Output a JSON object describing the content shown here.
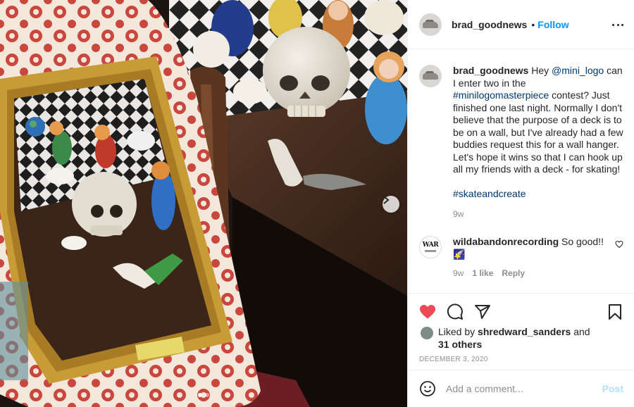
{
  "header": {
    "username": "brad_goodnews",
    "separator": "•",
    "follow_label": "Follow"
  },
  "caption": {
    "username": "brad_goodnews",
    "text_1": "Hey",
    "mention": "@mini_logo",
    "text_2": "can I enter two in the",
    "hashtag_1": "#minilogomasterpiece",
    "text_3": "contest? Just finished one last night. Normally I don't believe that the purpose of a deck is to be on a wall, but I've already had a few buddies request this for a wall hanger. Let's hope it wins so that I can hook up all my friends with a deck - for skating!",
    "hashtag_2": "#skateandcreate",
    "time": "9w"
  },
  "reply": {
    "avatar_text": "WAR",
    "username": "wildabandonrecording",
    "text": "So good!!",
    "emoji": "🌠",
    "time": "9w",
    "likes": "1 like",
    "reply_label": "Reply"
  },
  "likes": {
    "prefix": "Liked by",
    "user": "shredward_sanders",
    "and": "and",
    "others": "31 others"
  },
  "date": "DECEMBER 3, 2020",
  "add_comment": {
    "placeholder": "Add a comment...",
    "post_label": "Post"
  },
  "carousel": {
    "current": 1,
    "total": 2
  },
  "colors": {
    "accent": "#0095f6",
    "liked_heart": "#ed4956",
    "post_disabled": "#b2dffc",
    "mention": "#00376b"
  }
}
